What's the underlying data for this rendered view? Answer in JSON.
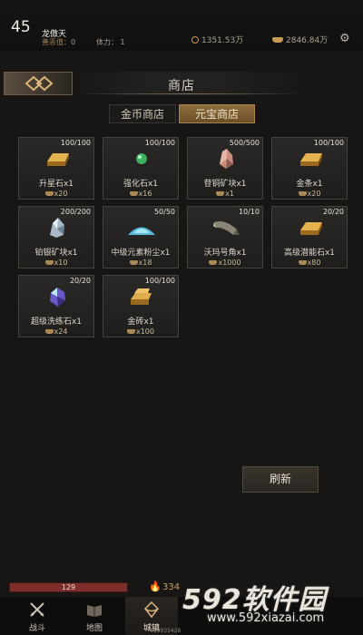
{
  "player": {
    "level": "45",
    "name": "龙傲天",
    "merit_label": "善恶值：",
    "merit_value": "0",
    "stamina": "体力： 1",
    "gold": "1351.53万",
    "yuanbao": "2846.84万"
  },
  "shop": {
    "title": "商店",
    "tabs": [
      {
        "label": "金币商店",
        "active": false
      },
      {
        "label": "元宝商店",
        "active": true
      }
    ],
    "items": [
      {
        "name": "升星石x1",
        "stock": "100/100",
        "price": "x20",
        "icon": "gold-bar-icon"
      },
      {
        "name": "强化石x1",
        "stock": "100/100",
        "price": "x16",
        "icon": "green-orb-icon"
      },
      {
        "name": "苷铜矿块x1",
        "stock": "500/500",
        "price": "x1",
        "icon": "copper-ore-icon"
      },
      {
        "name": "金条x1",
        "stock": "100/100",
        "price": "x20",
        "icon": "gold-bar-icon"
      },
      {
        "name": "铂银矿块x1",
        "stock": "200/200",
        "price": "x10",
        "icon": "silver-ore-icon"
      },
      {
        "name": "中级元素粉尘x1",
        "stock": "50/50",
        "price": "x18",
        "icon": "blue-dust-icon"
      },
      {
        "name": "沃玛号角x1",
        "stock": "10/10",
        "price": "x1000",
        "icon": "horn-icon"
      },
      {
        "name": "高级潜能石x1",
        "stock": "20/20",
        "price": "x80",
        "icon": "gold-bar-icon"
      },
      {
        "name": "超级洗练石x1",
        "stock": "20/20",
        "price": "x24",
        "icon": "crystal-icon"
      },
      {
        "name": "金砖x1",
        "stock": "100/100",
        "price": "x100",
        "icon": "gold-brick-icon"
      }
    ],
    "refresh_label": "刷新"
  },
  "status": {
    "hp_value": "129",
    "fire_power": "334"
  },
  "nav": [
    {
      "label": "战斗",
      "icon": "crossed-swords-icon",
      "active": false
    },
    {
      "label": "地图",
      "icon": "map-book-icon",
      "active": false
    },
    {
      "label": "城镇",
      "icon": "town-emblem-icon",
      "active": true
    }
  ],
  "exp_text": "419935428",
  "watermark": {
    "brand": "592软件园",
    "url": "www.592xiazai.com"
  },
  "colors": {
    "accent_gold": "#a8844c",
    "hp_red": "#7e2e2a",
    "background": "#171614"
  }
}
